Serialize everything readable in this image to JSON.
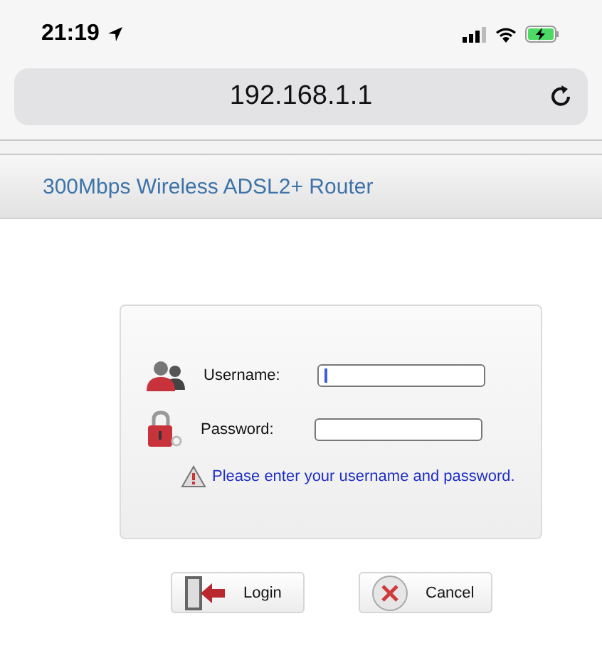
{
  "status_bar": {
    "time": "21:19"
  },
  "address_bar": {
    "url": "192.168.1.1"
  },
  "header": {
    "title": "300Mbps Wireless ADSL2+ Router"
  },
  "login": {
    "fields": [
      {
        "kind": "user",
        "label": "Username:",
        "focused": true
      },
      {
        "kind": "password",
        "label": "Password:",
        "focused": false
      }
    ],
    "message": "Please enter your username and password.",
    "buttons": [
      {
        "kind": "login",
        "label": "Login"
      },
      {
        "kind": "cancel",
        "label": "Cancel"
      }
    ]
  }
}
